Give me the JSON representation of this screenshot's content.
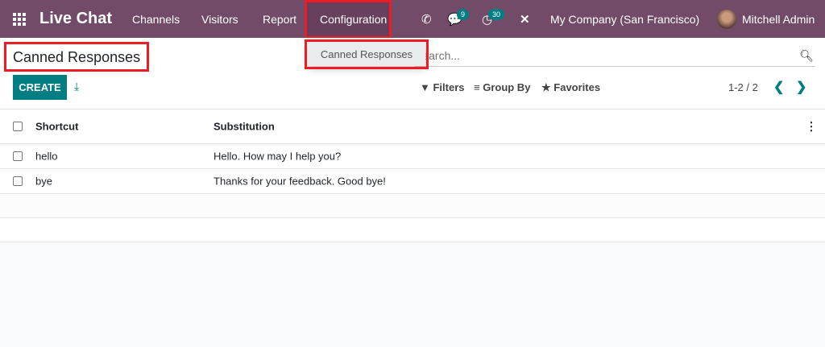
{
  "navbar": {
    "app_name": "Live Chat",
    "menus": [
      "Channels",
      "Visitors",
      "Report",
      "Configuration"
    ],
    "messages_badge": "9",
    "activities_badge": "30",
    "company": "My Company (San Francisco)",
    "user": "Mitchell Admin",
    "color": "#714b67"
  },
  "dropdown": {
    "items": [
      "Canned Responses"
    ]
  },
  "page": {
    "title": "Canned Responses",
    "create_label": "CREATE"
  },
  "search": {
    "placeholder": "Search..."
  },
  "filters": {
    "filters": "Filters",
    "group_by": "Group By",
    "favorites": "Favorites"
  },
  "pager": {
    "text": "1-2 / 2"
  },
  "table": {
    "headers": [
      "Shortcut",
      "Substitution"
    ],
    "rows": [
      [
        "hello",
        "Hello. How may I help you?"
      ],
      [
        "bye",
        "Thanks for your feedback. Good bye!"
      ]
    ]
  },
  "colors": {
    "accent": "#017e84",
    "highlight": "#ed1c24"
  }
}
